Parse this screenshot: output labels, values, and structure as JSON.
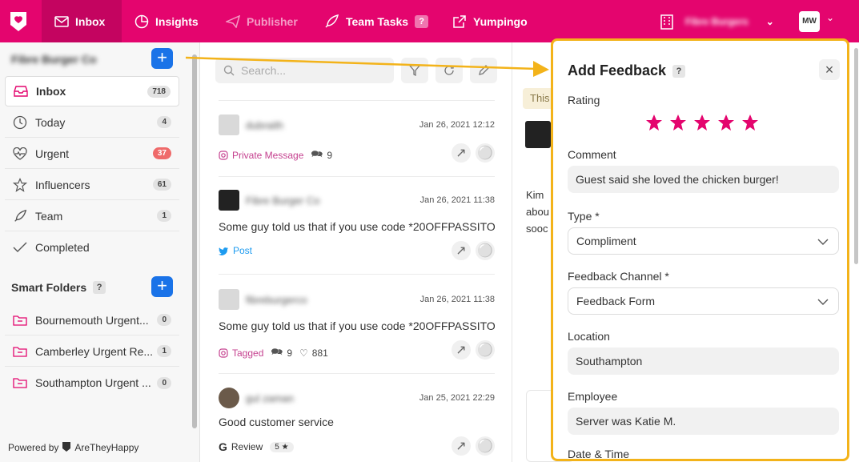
{
  "topbar": {
    "nav": [
      {
        "label": "Inbox",
        "icon": "envelope-icon"
      },
      {
        "label": "Insights",
        "icon": "chart-icon"
      },
      {
        "label": "Publisher",
        "icon": "paper-plane-icon"
      },
      {
        "label": "Team Tasks",
        "icon": "rocket-icon",
        "help": "?"
      },
      {
        "label": "Yumpingo",
        "icon": "external-link-icon"
      }
    ],
    "location": "Fibre Burgers",
    "avatar": "MW"
  },
  "sidebar": {
    "account": "Fibre Burger Co",
    "items": [
      {
        "label": "Inbox",
        "count": "718",
        "icon": "inbox-icon"
      },
      {
        "label": "Today",
        "count": "4",
        "icon": "clock-icon"
      },
      {
        "label": "Urgent",
        "count": "37",
        "icon": "heartbeat-icon"
      },
      {
        "label": "Influencers",
        "count": "61",
        "icon": "star-icon"
      },
      {
        "label": "Team",
        "count": "1",
        "icon": "rocket-icon"
      },
      {
        "label": "Completed",
        "count": "",
        "icon": "check-icon"
      }
    ],
    "smart_folders_title": "Smart Folders",
    "smart_help": "?",
    "folders": [
      {
        "label": "Bournemouth Urgent...",
        "count": "0"
      },
      {
        "label": "Camberley Urgent Re...",
        "count": "1"
      },
      {
        "label": "Southampton Urgent ...",
        "count": "0"
      }
    ],
    "powered": "Powered by",
    "brand": "AreTheyHappy"
  },
  "feed": {
    "search_placeholder": "Search...",
    "cards": [
      {
        "name": "dubraith",
        "date": "Jan 26, 2021 12:12",
        "text": "",
        "source": "Private Message",
        "meta1": "9",
        "meta2": ""
      },
      {
        "name": "Fibre Burger Co",
        "date": "Jan 26, 2021 11:38",
        "text": "Some guy told us that if you use code *20OFFPASSITO...",
        "source": "Post",
        "meta1": "",
        "meta2": ""
      },
      {
        "name": "fibreburgerco",
        "date": "Jan 26, 2021 11:38",
        "text": "Some guy told us that if you use code *20OFFPASSITO...",
        "source": "Tagged",
        "meta1": "9",
        "meta2": "881"
      },
      {
        "name": "gul zaman",
        "date": "Jan 25, 2021 22:29",
        "text": "Good customer service",
        "source": "Review",
        "meta1": "5 ★",
        "meta2": ""
      }
    ]
  },
  "convo": {
    "banner": "This",
    "snippet": [
      "Kim",
      "abou",
      "sooc"
    ]
  },
  "feedback": {
    "title": "Add Feedback",
    "help": "?",
    "rating_label": "Rating",
    "rating": 5,
    "comment_label": "Comment",
    "comment": "Guest said she loved the chicken burger!",
    "type_label": "Type *",
    "type": "Compliment",
    "channel_label": "Feedback Channel *",
    "channel": "Feedback Form",
    "location_label": "Location",
    "location": "Southampton",
    "employee_label": "Employee",
    "employee": "Server was Katie M.",
    "date_label": "Date & Time",
    "star_color": "#e4056e",
    "highlight_color": "#f3b31a"
  }
}
